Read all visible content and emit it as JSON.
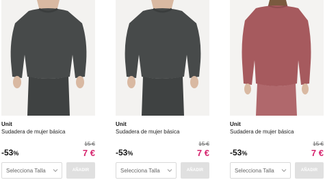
{
  "products": [
    {
      "brand": "Unit",
      "name": "Sudadera de mujer básica",
      "discount_value": "-53",
      "discount_suffix": "%",
      "old_price": "15 €",
      "new_price": "7 €",
      "size_placeholder": "Selecciona Talla",
      "add_label": "AÑADIR",
      "image": {
        "view": "front",
        "garment_color": "#474a4a"
      }
    },
    {
      "brand": "Unit",
      "name": "Sudadera de mujer básica",
      "discount_value": "-53",
      "discount_suffix": "%",
      "old_price": "15 €",
      "new_price": "7 €",
      "size_placeholder": "Selecciona Talla",
      "add_label": "AÑADIR",
      "image": {
        "view": "front",
        "garment_color": "#474a4a"
      }
    },
    {
      "brand": "Unit",
      "name": "Sudadera de mujer básica",
      "discount_value": "-53",
      "discount_suffix": "%",
      "old_price": "15 €",
      "new_price": "7 €",
      "size_placeholder": "Selecciona Talla",
      "add_label": "AÑADIR",
      "image": {
        "view": "back",
        "garment_color": "#a65a5e"
      }
    }
  ],
  "colors": {
    "sale_price": "#d6246e",
    "button_disabled": "#e0e0e0"
  },
  "icons": {
    "select": "chevron-down-icon"
  }
}
